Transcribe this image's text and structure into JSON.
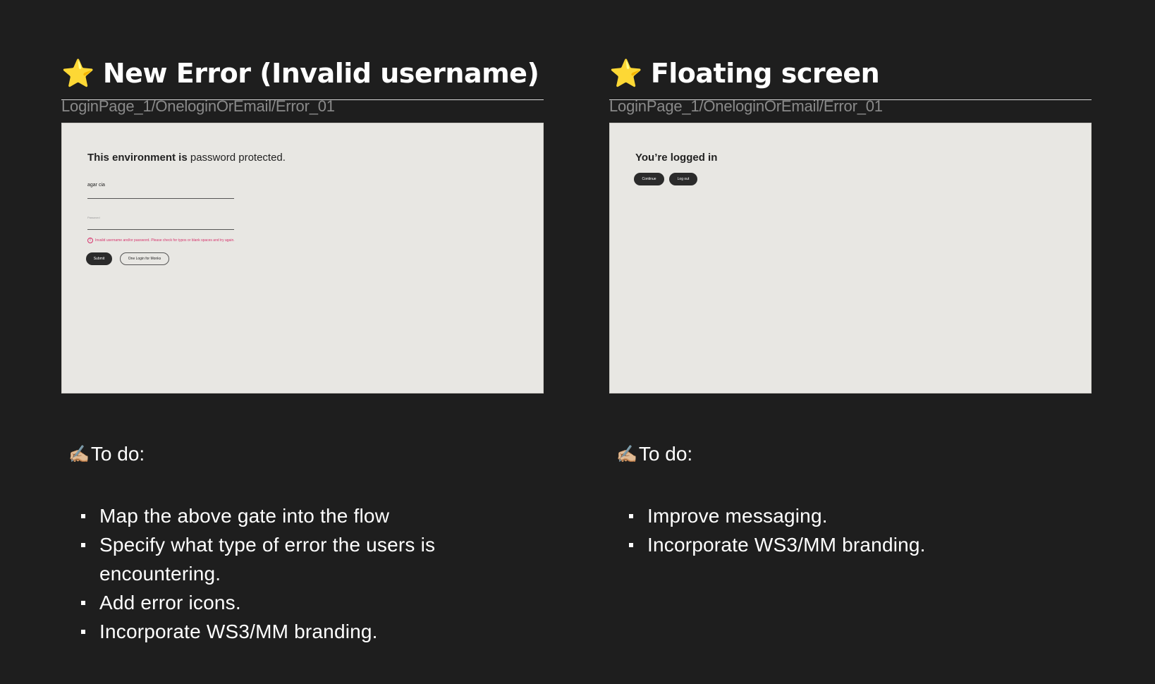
{
  "left": {
    "title": "New Error (Invalid username)",
    "star_icon": "⭐",
    "path": "LoginPage_1/OneloginOrEmail/Error_01",
    "frame": {
      "env_bold": "This environment is",
      "env_rest": " password protected.",
      "username_value": "agar cia",
      "password_placeholder": "Password",
      "error_icon": "!",
      "error_text": "Invalid username and/or password. Please check for typos or blank spaces and try again.",
      "submit_label": "Submit",
      "onelogin_label": "One Login for Monks"
    },
    "todo_icon": "✍🏼",
    "todo_heading": "To do:",
    "todo_items": [
      "Map the above gate into the flow",
      "Specify what type of error the users is encountering.",
      "Add error icons.",
      "Incorporate WS3/MM branding."
    ]
  },
  "right": {
    "title": "Floating screen",
    "star_icon": "⭐",
    "path": "LoginPage_1/OneloginOrEmail/Error_01",
    "frame": {
      "logged_in_text": "You’re logged in",
      "continue_label": "Continue",
      "logout_label": "Log out"
    },
    "todo_icon": "✍🏼",
    "todo_heading": "To do:",
    "todo_items": [
      "Improve messaging.",
      "Incorporate WS3/MM branding."
    ]
  },
  "colors": {
    "background": "#1e1e1e",
    "frame_background": "#e8e7e3",
    "error_pink": "#d6336c",
    "button_dark": "#2b2b2b"
  }
}
